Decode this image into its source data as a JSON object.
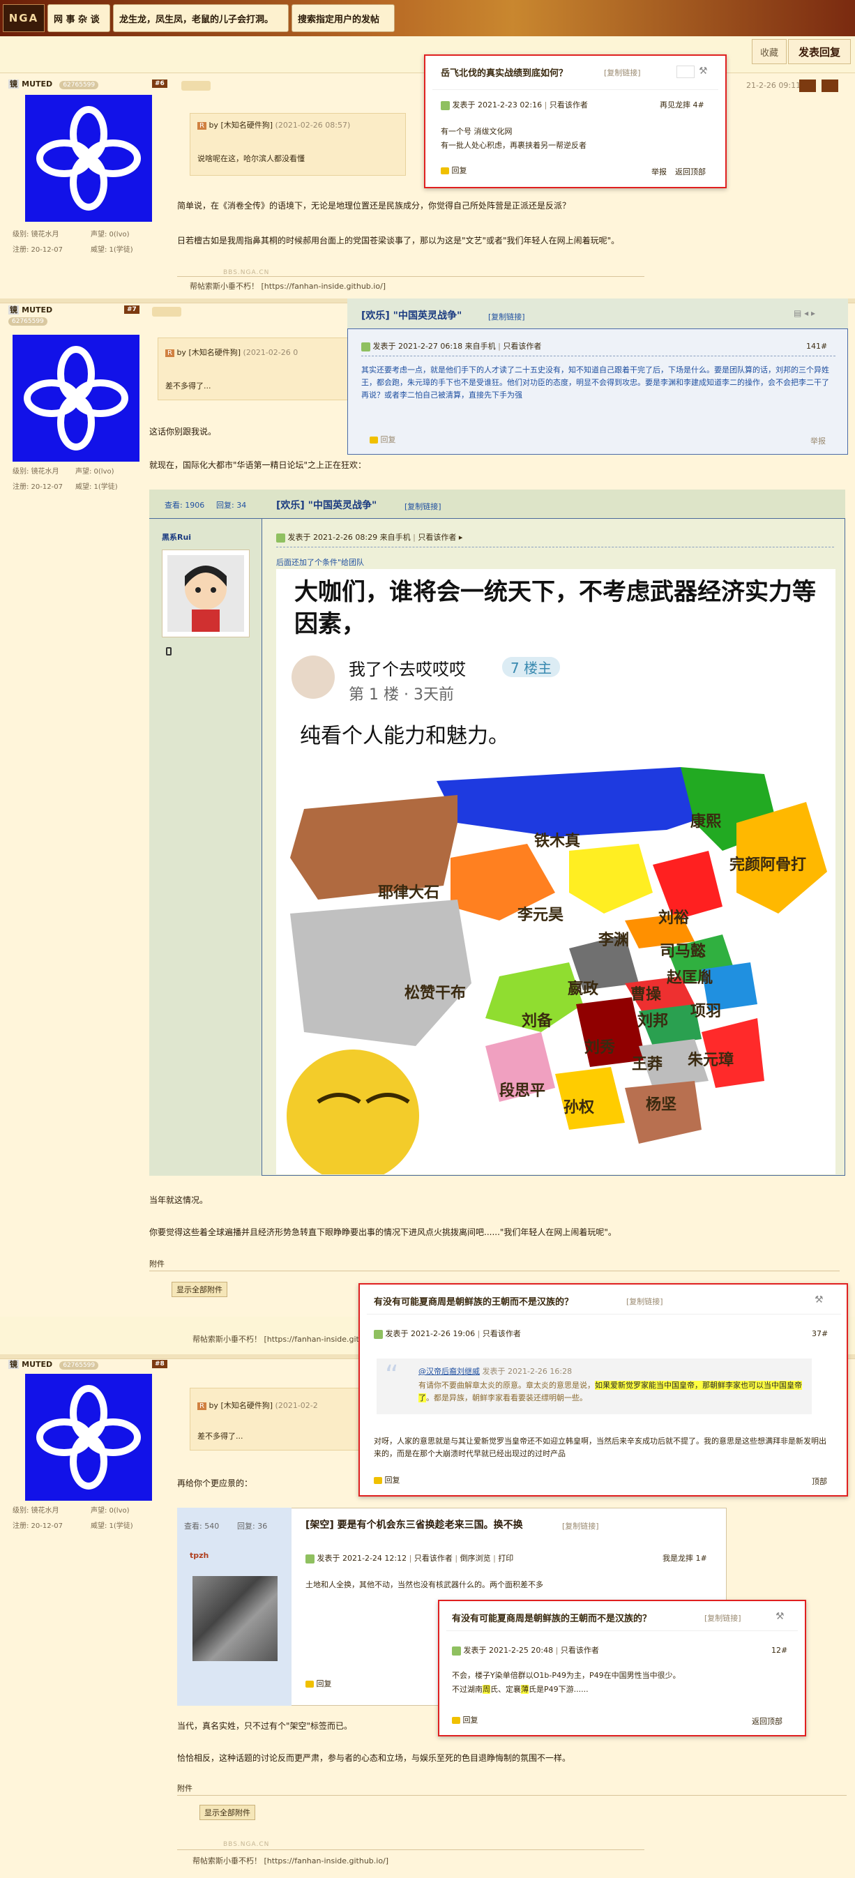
{
  "nav": {
    "logo": "NGA",
    "crumb1": "网 事 杂 谈",
    "crumb2": "龙生龙，凤生凤，老鼠的儿子会打洞。",
    "crumb3": "搜索指定用户的发帖",
    "fav": "收藏",
    "reply": "发表回复"
  },
  "user": {
    "name": "MUTED",
    "id": "62765599",
    "tag": "镜",
    "level": "级别: 镜花水月",
    "fame": "声望: 0(lvo)",
    "reg": "注册: 20-12-07",
    "power": "威望: 1(学徒)"
  },
  "post6": {
    "floor": "#6",
    "quote_author": "by [木知名硬件狗]",
    "quote_date": "(2021-02-26 08:57)",
    "quote_text": "说啥呢在这，哈尔滨人都没看懂",
    "p1": "简单说，在《消卷全传》的语境下，无论是地理位置还是民族成分，你觉得自己所处阵营是正派还是反派？",
    "p2": "日若檀古如是我周指鼻其桐的时候郝用台面上的党国苍梁谈事了，那以为这是\"文艺\"或者\"我们年轻人在网上闹着玩呢\"。",
    "wm": "BBS.NGA.CN",
    "sig": "帮帖索斯小垂不朽！ [https://fanhan-inside.github.io/]",
    "date": "21-2-26 09:11"
  },
  "post7": {
    "floor": "#7",
    "quote_author": "by [木知名硬件狗]",
    "quote_date": "(2021-02-26 0",
    "quote_text": "差不多得了...",
    "p1": "这话你别跟我说。",
    "p2": "就现在，国际化大都市\"华语第一精日论坛\"之上正在狂欢："
  },
  "embed": {
    "views": "查看: 1906",
    "replies": "回复: 34",
    "title": "[欢乐]  \"中国英灵战争\"",
    "copy": "[复制链接]",
    "author": "黑系Rui",
    "meta": "发表于 2021-2-26 08:29 来自手机",
    "only": "只看该作者",
    "note": "后面还加了个条件\"给团队",
    "img_title": "大咖们，谁将会一统天下，不考虑武器经济实力等因素，",
    "img_user": "我了个去哎哎哎",
    "img_badge": "7 楼主",
    "img_floor": "第 1 楼 · 3天前",
    "img_text": "纯看个人能力和魅力。",
    "regions": [
      "铁木真",
      "康熙",
      "完颜阿骨打",
      "耶律大石",
      "李元昊",
      "刘裕",
      "李渊",
      "司马懿",
      "赵匡胤",
      "松赞干布",
      "嬴政",
      "曹操",
      "项羽",
      "刘备",
      "刘邦",
      "朱元璋",
      "刘秀",
      "王莽",
      "段思平",
      "孙权",
      "杨坚"
    ]
  },
  "post7b": {
    "p3": "当年就这情况。",
    "p4": "你要觉得这些着全球遍播并且经济形势急转直下眼睁睁要出事的情况下进风点火挑拨离间吧......\"我们年轻人在网上闹着玩呢\"。",
    "attach": "附件",
    "attach_btn": "显示全部附件",
    "sig": "帮帖索斯小垂不朽！ [https://fanhan-inside.githu"
  },
  "post8": {
    "floor": "#8",
    "quote_author": "by [木知名硬件狗]",
    "quote_date": "(2021-02-2",
    "quote_text": "差不多得了...",
    "p1": "再给你个更应景的：",
    "embed_views": "查看: 540",
    "embed_replies": "回复: 36",
    "embed_title": "[架空]  要是有个机会东三省换趁老来三国。换不换",
    "embed_copy": "[复制链接]",
    "embed_author": "tpzh",
    "embed_meta": "发表于 2021-2-24 12:12",
    "embed_only": "只看该作者",
    "embed_opts": "倒序浏览",
    "embed_print": "打印",
    "embed_floor": "我是龙摔 1#",
    "embed_text": "土地和人全换，其他不动，当然也没有核武器什么的。两个面积差不多",
    "embed_reply": "回复",
    "p2": "当代，真名实姓，只不过有个\"架空\"标签而已。",
    "p3": "恰恰相反，这种话题的讨论反而更严肃，参与者的心态和立场，与娱乐至死的色目退睁悔制的氛围不一样。",
    "attach": "附件",
    "attach_btn": "显示全部附件",
    "wm": "BBS.NGA.CN",
    "sig": "帮帖索斯小垂不朽！ [https://fanhan-inside.github.io/]"
  },
  "pop1": {
    "title": "岳飞北伐的真实战绩到底如何？",
    "copy": "[复制链接]",
    "meta": "发表于 2021-2-23 02:16",
    "only": "只看该作者",
    "floor": "再见龙摔 4#",
    "l1": "有一个号 消绂文化网",
    "l2": "有一批人处心积虑，再裹挟着另一帮逆反者",
    "reply": "回复",
    "report": "举报",
    "top": "返回顶部"
  },
  "pop2": {
    "title": "[欢乐]  \"中国英灵战争\"",
    "copy": "[复制链接]",
    "meta": "发表于 2021-2-27 06:18 来自手机",
    "only": "只看该作者",
    "floor": "141#",
    "text": "其实还要考虑一点，就是他们手下的人才读了二十五史没有，知不知道自己跟着干完了后，下场是什么。要是团队算的话，刘邦的三个异姓王，都会跑，朱元璋的手下也不是受谁狂。他们对功臣的态度，明显不会得到攻忠。要是李渊和李建成知道李二的操作，会不会把李二干了再说？或者李二怕自己被清算，直接先下手为强",
    "reply": "回复",
    "report": "举报"
  },
  "pop3": {
    "title": "有没有可能夏商周是朝鲜族的王朝而不是汉族的？",
    "copy": "[复制链接]",
    "meta": "发表于 2021-2-26 19:06",
    "only": "只看该作者",
    "floor": "37#",
    "q_author": "@汉帝后裔刘继威",
    "q_date": "发表于 2021-2-26 16:28",
    "q_text1": "有请你不要曲解章太炎的原意。章太炎的意思是说，",
    "q_hl": "如果爱新觉罗家能当中国皇帝，那朝鲜李家也可以当中国皇帝了",
    "q_text2": "。都是异族，朝鲜李家看看要装还缥明朝一些。",
    "text": "对呀，人家的意思就是与其让爱新觉罗当皇帝还不如迎立韩皇啊，当然后来辛亥成功后就不提了。我的意思是这些想满拜非是新发明出来的，而是在那个大崩溃时代早就已经出现过的过时产品",
    "reply": "回复",
    "top": "顶部"
  },
  "pop4": {
    "title": "有没有可能夏商周是朝鲜族的王朝而不是汉族的？",
    "copy": "[复制链接]",
    "meta": "发表于 2021-2-25 20:48",
    "only": "只看该作者",
    "floor": "12#",
    "l1": "不会，楼子Y染单倍群以O1b-P49为主，P49在中国男性当中很少。",
    "l2a": "不过湖南",
    "l2h1": "周",
    "l2b": "氏、定襄",
    "l2h2": "薄",
    "l2c": "氏是P49下游......",
    "reply": "回复",
    "top": "返回顶部"
  }
}
